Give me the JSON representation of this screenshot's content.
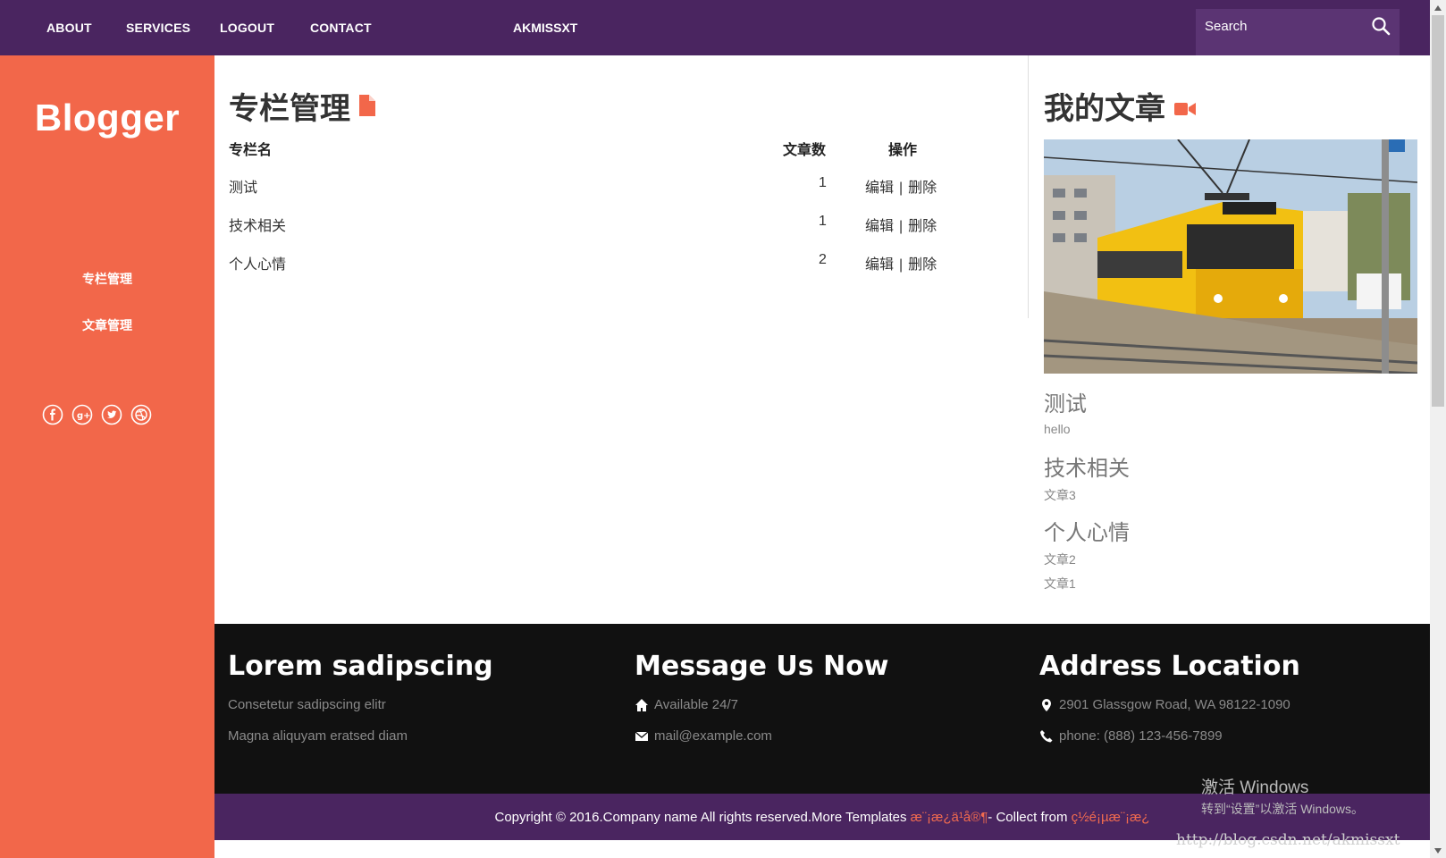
{
  "nav": {
    "items": [
      {
        "label": "ABOUT"
      },
      {
        "label": "SERVICES"
      },
      {
        "label": "LOGOUT"
      },
      {
        "label": "CONTACT"
      }
    ],
    "brand": "AKMISSXT",
    "search_placeholder": "Search"
  },
  "sidebar": {
    "logo": "Blogger",
    "links": [
      {
        "label": "专栏管理"
      },
      {
        "label": "文章管理"
      }
    ],
    "social_icons": [
      "facebook-icon",
      "google-plus-icon",
      "twitter-icon",
      "dribbble-icon"
    ]
  },
  "main": {
    "title": "专栏管理",
    "columns": {
      "name": "专栏名",
      "count": "文章数",
      "ops": "操作"
    },
    "rows": [
      {
        "name": "测试",
        "count": "1",
        "edit": "编辑",
        "sep": "|",
        "delete": "删除"
      },
      {
        "name": "技术相关",
        "count": "1",
        "edit": "编辑",
        "sep": "|",
        "delete": "删除"
      },
      {
        "name": "个人心情",
        "count": "2",
        "edit": "编辑",
        "sep": "|",
        "delete": "删除"
      }
    ]
  },
  "right": {
    "title": "我的文章",
    "categories": [
      {
        "name": "测试",
        "articles": [
          "hello"
        ]
      },
      {
        "name": "技术相关",
        "articles": [
          "文章3"
        ]
      },
      {
        "name": "个人心情",
        "articles": [
          "文章2",
          "文章1"
        ]
      }
    ]
  },
  "footer": {
    "col1": {
      "title": "Lorem sadipscing",
      "lines": [
        "Consetetur sadipscing elitr",
        "Magna aliquyam eratsed diam"
      ]
    },
    "col2": {
      "title": "Message Us Now",
      "lines": [
        "Available 24/7",
        "mail@example.com"
      ]
    },
    "col3": {
      "title": "Address Location",
      "lines": [
        "2901 Glassgow Road, WA 98122-1090",
        "phone: (888) 123-456-7899"
      ]
    },
    "copyright": "Copyright © 2016.Company name All rights reserved.More Templates ",
    "link1": "æ¨¡æ¿ä¹å®¶",
    "mid": " - Collect from ",
    "link2": "ç½é¡µæ¨¡æ¿"
  },
  "overlay": {
    "activate_title": "激活 Windows",
    "activate_sub": "转到“设置”以激活 Windows。",
    "watermark": "http://blog.csdn.net/akmissxt"
  },
  "colors": {
    "nav_bg": "#4a2560",
    "sidebar_bg": "#f2674a",
    "footer_bg": "#111111",
    "accent": "#f26b4f"
  }
}
